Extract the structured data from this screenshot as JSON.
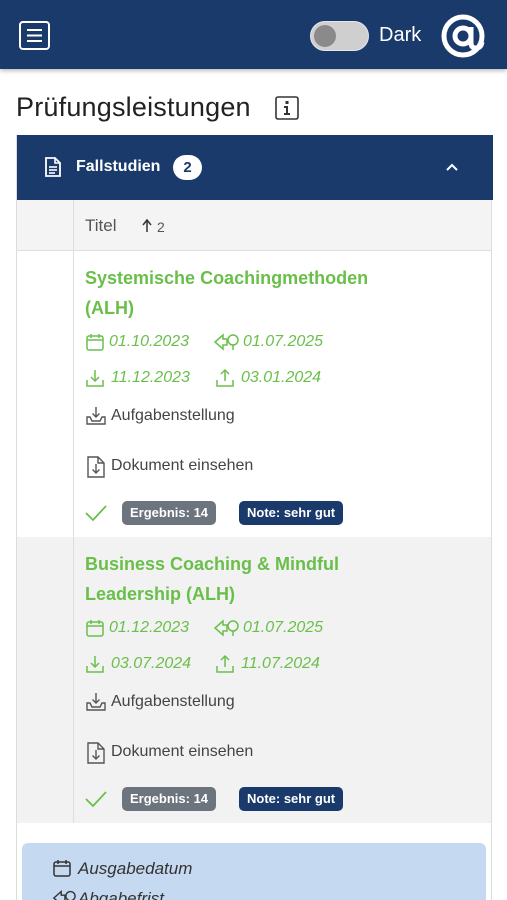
{
  "header": {
    "toggle_label": "Dark",
    "brand": "@"
  },
  "page": {
    "title": "Prüfungsleistungen"
  },
  "section": {
    "label": "Fallstudien",
    "count": "2",
    "columns": {
      "title": "Titel",
      "sort_index": "2"
    }
  },
  "rows": [
    {
      "title": "Systemische Coachingmethoden (ALH)",
      "ausgabedatum": "01.10.2023",
      "abgabefrist": "01.07.2025",
      "download_date": "11.12.2023",
      "upload_date": "03.01.2024",
      "assignment_label": "Aufgabenstellung",
      "document_label": "Dokument einsehen",
      "result": "Ergebnis: 14",
      "grade": "Note: sehr gut"
    },
    {
      "title": "Business Coaching & Mindful Leadership (ALH)",
      "ausgabedatum": "01.12.2023",
      "abgabefrist": "01.07.2025",
      "download_date": "03.07.2024",
      "upload_date": "11.07.2024",
      "assignment_label": "Aufgabenstellung",
      "document_label": "Dokument einsehen",
      "result": "Ergebnis: 14",
      "grade": "Note: sehr gut"
    }
  ],
  "legend": {
    "items": [
      "Ausgabedatum",
      "Abgabefrist"
    ]
  },
  "colors": {
    "brand_navy": "#1a3a6b",
    "accent_green": "#6abf4b",
    "badge_grey": "#6c757d",
    "legend_bg": "#c5d9f1"
  },
  "icons": [
    "menu-icon",
    "toggle-switch",
    "at-logo-icon",
    "info-icon",
    "file-icon",
    "chevron-up-icon",
    "sort-up-icon",
    "calendar-icon",
    "deadline-icon",
    "download-icon",
    "upload-icon",
    "inbox-download-icon",
    "document-download-icon",
    "check-icon"
  ]
}
